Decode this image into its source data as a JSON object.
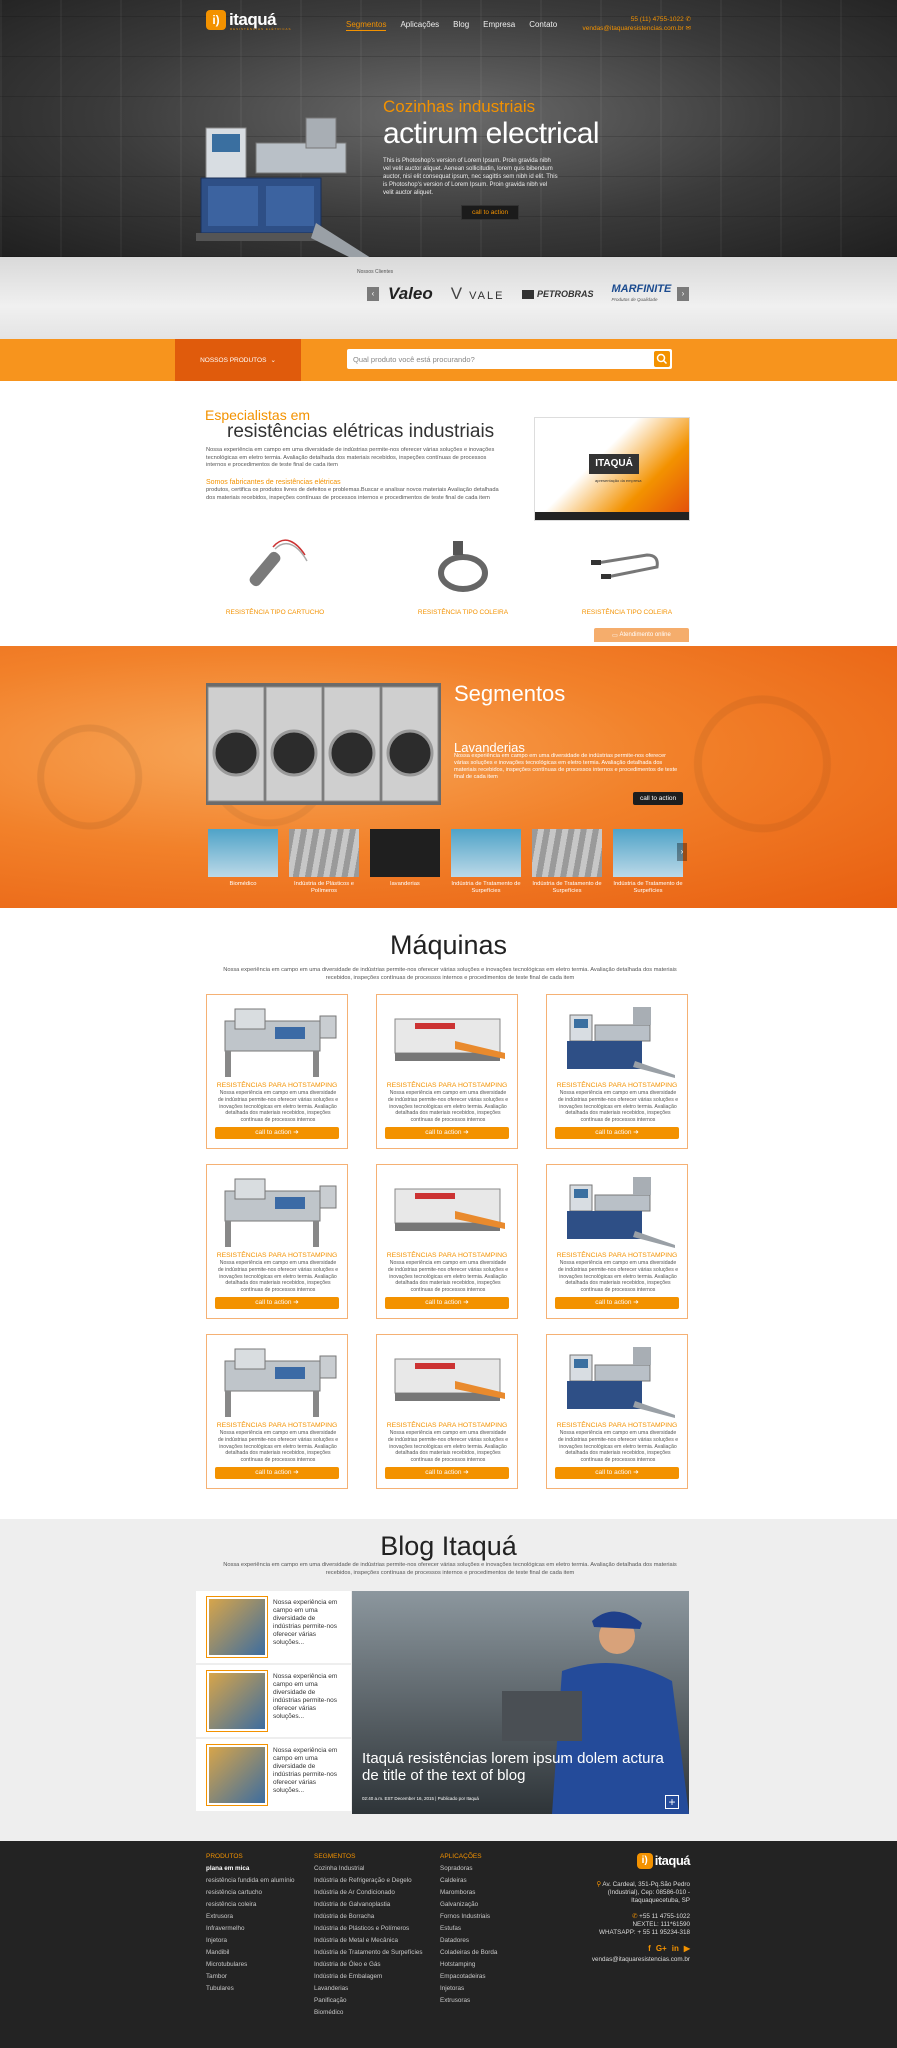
{
  "header": {
    "logo": "itaquá",
    "logo_sub": "RESISTÊNCIAS ELÉTRICAS",
    "nav": [
      "Segmentos",
      "Aplicações",
      "Blog",
      "Empresa",
      "Contato"
    ],
    "phone": "55 (11) 4755-1022",
    "email": "vendas@itaquaresistencias.com.br"
  },
  "hero": {
    "subtitle": "Cozinhas industriais",
    "title": "actirum electrical",
    "description": "This is Photoshop's version of Lorem Ipsum. Proin gravida nibh vel velit auctor aliquet. Aenean sollicitudin, lorem quis bibendum auctor, nisi elit consequat ipsum, nec sagittis sem nibh id elit. This is Photoshop's version of Lorem Ipsum. Proin gravida nibh vel velit auctor aliquet.",
    "cta": "call to action"
  },
  "clients": {
    "label": "Nossos Clientes",
    "logos": [
      "Valeo",
      "VALE",
      "PETROBRAS",
      "MARFINITE"
    ],
    "logo_tagline": "Produtos de Qualidade"
  },
  "searchbar": {
    "products_button": "NOSSOS PRODUTOS",
    "placeholder": "Qual produto você está procurando?"
  },
  "specialists": {
    "heading_small": "Especialistas em",
    "heading_large": "resistências elétricas industriais",
    "paragraph1": "Nossa experiência em campo em uma diversidade de indústrias permite-nos oferecer várias soluções e inovações tecnológicas em eletro termia. Avaliação detalhada dos materiais recebidos, inspeções contínuas de processos internos e procedimentos de teste final de cada item",
    "subheading": "Somos fabricantes de resistências elétricas",
    "paragraph2": "produtos, certifica os produtos livres de defeitos e problemas.Buscar e analisar novos materiais Avaliação detalhada dos materiais recebidos, inspeções contínuas de processos internos e procedimentos de teste final de cada item",
    "video_logo": "ITAQUÁ",
    "video_caption": "apresentação da empresa",
    "products": [
      "RESISTÊNCIA TIPO CARTUCHO",
      "RESISTÊNCIA TIPO COLEIRA",
      "RESISTÊNCIA TIPO COLEIRA"
    ],
    "chat": "Atendimento online"
  },
  "segments": {
    "title": "Segmentos",
    "current": "Lavanderias",
    "description": "Nossa experiência em campo em uma diversidade de indústrias permite-nos oferecer várias soluções e inovações tecnológicas em eletro termia. Avaliação detalhada dos materiais recebidos, inspeções contínuas de processos internos e procedimentos de teste final de cada item",
    "cta": "call to action",
    "thumbs": [
      "Biomédico",
      "Indústria de Plásticos e Polímeros",
      "lavanderias",
      "Indústria de Tratamento de Surpefícies",
      "Indústria de Tratamento de Surpefícies",
      "Indústria de Tratamento de Surpefícies"
    ]
  },
  "machines": {
    "title": "Máquinas",
    "description": "Nossa experiência em campo em uma diversidade de indústrias permite-nos oferecer várias soluções e inovações tecnológicas em eletro termia. Avaliação detalhada dos materiais recebidos, inspeções contínuas de processos internos e procedimentos de teste final de cada item",
    "card_title": "RESISTÊNCIAS PARA HOTSTAMPING",
    "card_desc": "Nossa experiência em campo em uma diversidade de indústrias permite-nos oferecer várias soluções e inovações tecnológicas em eletro termia. Avaliação detalhada dos materiais recebidos, inspeções contínuas de processos internos",
    "card_cta": "call to action"
  },
  "blog": {
    "title": "Blog Itaquá",
    "description": "Nossa experiência em campo em uma diversidade de indústrias permite-nos oferecer várias soluções e inovações tecnológicas em eletro termia. Avaliação detalhada dos materiais recebidos, inspeções contínuas de processos internos e procedimentos de teste final de cada item",
    "items": [
      "Nossa experiência em campo em uma diversidade de indústrias permite-nos oferecer várias soluções...",
      "Nossa experiência em campo em uma diversidade de indústrias permite-nos oferecer várias soluções...",
      "Nossa experiência em campo em uma diversidade de indústrias permite-nos oferecer várias soluções..."
    ],
    "featured_title": "Itaquá resistências lorem ipsum dolem actura de title of the text of blog",
    "featured_meta": "02:40 a.m. EST December 16, 2015 | Publicado por Itaquá"
  },
  "footer": {
    "produtos_title": "PRODUTOS",
    "produtos": [
      "plana em mica",
      "resistência fundida em alumínio",
      "resistência cartucho",
      "resistência coleira",
      "Extrusora",
      "Infravermelho",
      "Injetora",
      "Mandibil",
      "Microtubulares",
      "Tambor",
      "Tubulares"
    ],
    "segmentos_title": "SEGMENTOS",
    "segmentos": [
      "Cozinha Industrial",
      "Indústria de Refrigeração e Degelo",
      "Indústria de Ar Condicionado",
      "Indústria de Galvanoplastia",
      "Indústria de Borracha",
      "Indústria de Plásticos e Polímeros",
      "Indústria de Metal e Mecânica",
      "Indústria de Tratamento de Surpefícies",
      "Indústria de Óleo e Gás",
      "Indústria de Embalagem",
      "Lavanderias",
      "Panificação",
      "Biomédico"
    ],
    "aplicacoes_title": "APLICAÇÕES",
    "aplicacoes": [
      "Sopradoras",
      "Caldeiras",
      "Maromboras",
      "Galvanização",
      "Fornos Industriais",
      "Estufas",
      "Datadores",
      "Coladeiras de Borda",
      "Hotstamping",
      "Empacotadeiras",
      "Injetoras",
      "Extrusoras"
    ],
    "address1": "Av. Cardeal, 351-Pq.São Pedro",
    "address2": "(Industrial), Cep: 08586-010 -",
    "address3": "Itaquaquecetuba, SP",
    "phone": "+55 11 4755-1022",
    "nextel": "NEXTEL: 111*61590",
    "whatsapp": "WHATSAPP: + 55 11 95234-318",
    "email": "vendas@itaquaresistencias.com.br"
  }
}
